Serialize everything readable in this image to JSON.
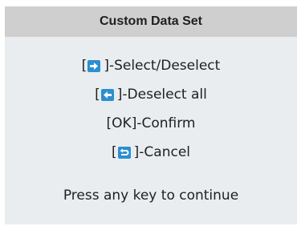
{
  "dialog": {
    "title": "Custom Data Set",
    "lines": [
      {
        "open": "[",
        "icon": "right-arrow-icon",
        "text": "]-Select/Deselect"
      },
      {
        "open": "[",
        "icon": "left-arrow-icon",
        "text": "]-Deselect all"
      },
      {
        "text": "[OK]-Confirm"
      },
      {
        "open": "[",
        "icon": "return-icon",
        "text": "]-Cancel"
      }
    ],
    "footer": "Press any key to continue"
  },
  "colors": {
    "title_bar": "#cfcfcf",
    "body_bg": "#e9edf0",
    "icon_blue": "#2b8fd0"
  }
}
